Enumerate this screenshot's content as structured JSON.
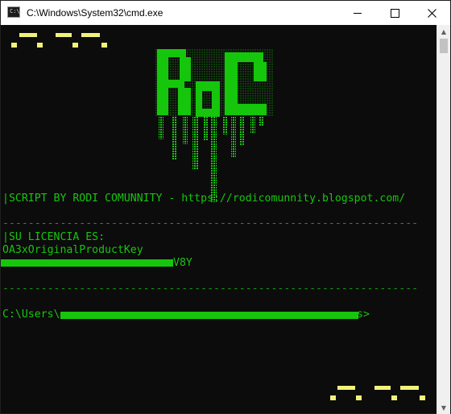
{
  "window": {
    "title": "C:\\Windows\\System32\\cmd.exe",
    "app_icon_text": "C:\\."
  },
  "console": {
    "script_line": "|SCRIPT BY RODI COMUNNITY - https://rodicomunnity.blogspot.com/",
    "separator_1": "-----------------------------------------------------------------",
    "licencia_label": "|SU LICENCIA ES:",
    "product_key_label": "OA3xOriginalProductKey",
    "key_visible_suffix": "V8Y",
    "separator_2": "-----------------------------------------------------------------",
    "prompt_prefix": "C:\\Users\\",
    "prompt_suffix": "s>"
  },
  "logo": {
    "text": "RC"
  },
  "colors": {
    "console_bg": "#0c0c0c",
    "green": "#16c60c",
    "yellow_deco": "#f2f27a",
    "titlebar": "#ffffff"
  }
}
